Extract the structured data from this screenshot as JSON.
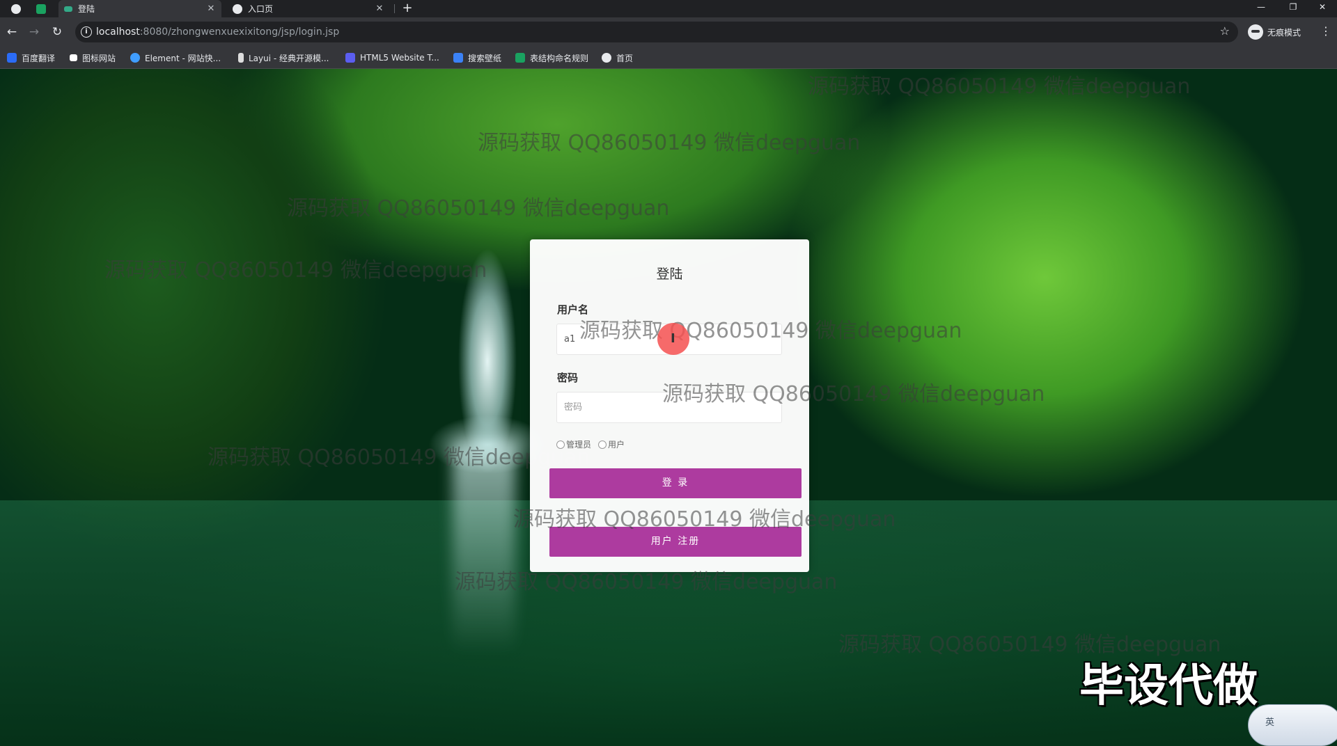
{
  "browser": {
    "tabs": [
      {
        "title": "登陆",
        "active": true
      },
      {
        "title": "入口页",
        "active": false
      }
    ],
    "url_host": "localhost",
    "url_path": ":8080/zhongwenxuexixitong/jsp/login.jsp",
    "profile_label": "无痕模式",
    "bookmarks": [
      {
        "label": "百度翻译",
        "color": "#2b6cf6"
      },
      {
        "label": "图标网站",
        "color": "#ffffff"
      },
      {
        "label": "Element - 网站快...",
        "color": "#409eff"
      },
      {
        "label": "Layui - 经典开源模...",
        "color": "#dddddd"
      },
      {
        "label": "HTML5 Website T...",
        "color": "#5b5ef0"
      },
      {
        "label": "搜索壁纸",
        "color": "#3b82f6"
      },
      {
        "label": "表结构命名规则",
        "color": "#1aa260"
      },
      {
        "label": "首页",
        "color": "#e8eaed"
      }
    ]
  },
  "watermark_text": "源码获取 QQ86050149 微信deepguan",
  "login": {
    "title": "登陆",
    "username_label": "用户名",
    "username_value": "a1",
    "password_label": "密码",
    "password_placeholder": "密码",
    "roles": [
      "管理员",
      "用户"
    ],
    "login_button": "登 录",
    "register_button": "用户 注册",
    "accent_color": "#ad3b9f"
  },
  "overlay": {
    "banner": "毕设代做",
    "ime_label": "英"
  }
}
